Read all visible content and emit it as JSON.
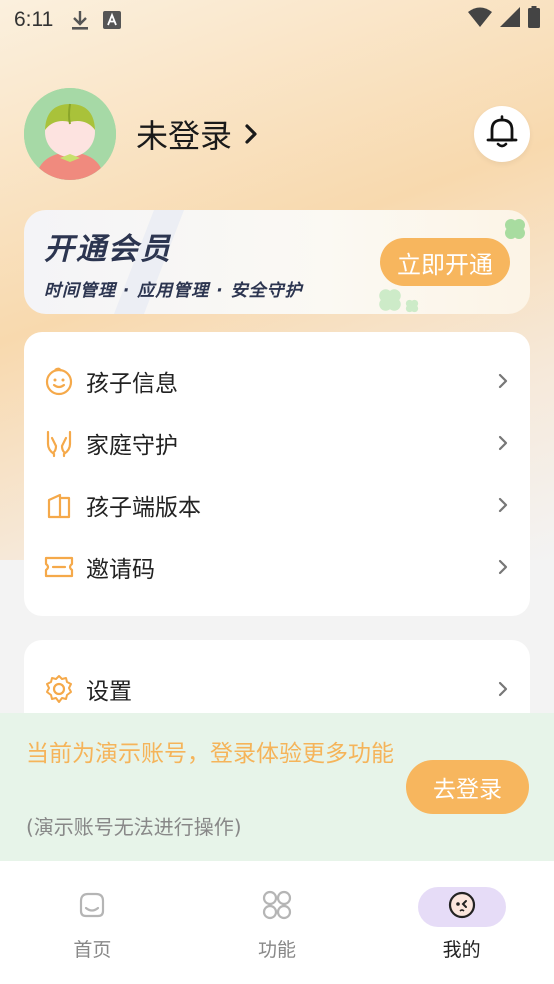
{
  "status_bar": {
    "time": "6:11",
    "icons": [
      "download-icon",
      "text-a-icon",
      "wifi-icon",
      "signal-icon",
      "battery-icon"
    ]
  },
  "profile": {
    "login_label": "未登录"
  },
  "vip": {
    "title": "开通会员",
    "subtitle": "时间管理 · 应用管理 · 安全守护",
    "button_label": "立即开通"
  },
  "menu": {
    "items": [
      {
        "label": "孩子信息",
        "icon": "baby-face-icon"
      },
      {
        "label": "家庭守护",
        "icon": "protect-hands-icon"
      },
      {
        "label": "孩子端版本",
        "icon": "device-icon"
      },
      {
        "label": "邀请码",
        "icon": "ticket-icon"
      }
    ],
    "settings_label": "设置"
  },
  "demo": {
    "message": "当前为演示账号，登录体验更多功能",
    "note": "(演示账号无法进行操作)",
    "login_button": "去登录"
  },
  "nav": {
    "items": [
      {
        "label": "首页",
        "active": false
      },
      {
        "label": "功能",
        "active": false
      },
      {
        "label": "我的",
        "active": true
      }
    ]
  },
  "colors": {
    "accent_orange": "#f7b65e",
    "demo_bg": "#e7f4e9",
    "active_tab_bg": "#e6dcf7"
  }
}
